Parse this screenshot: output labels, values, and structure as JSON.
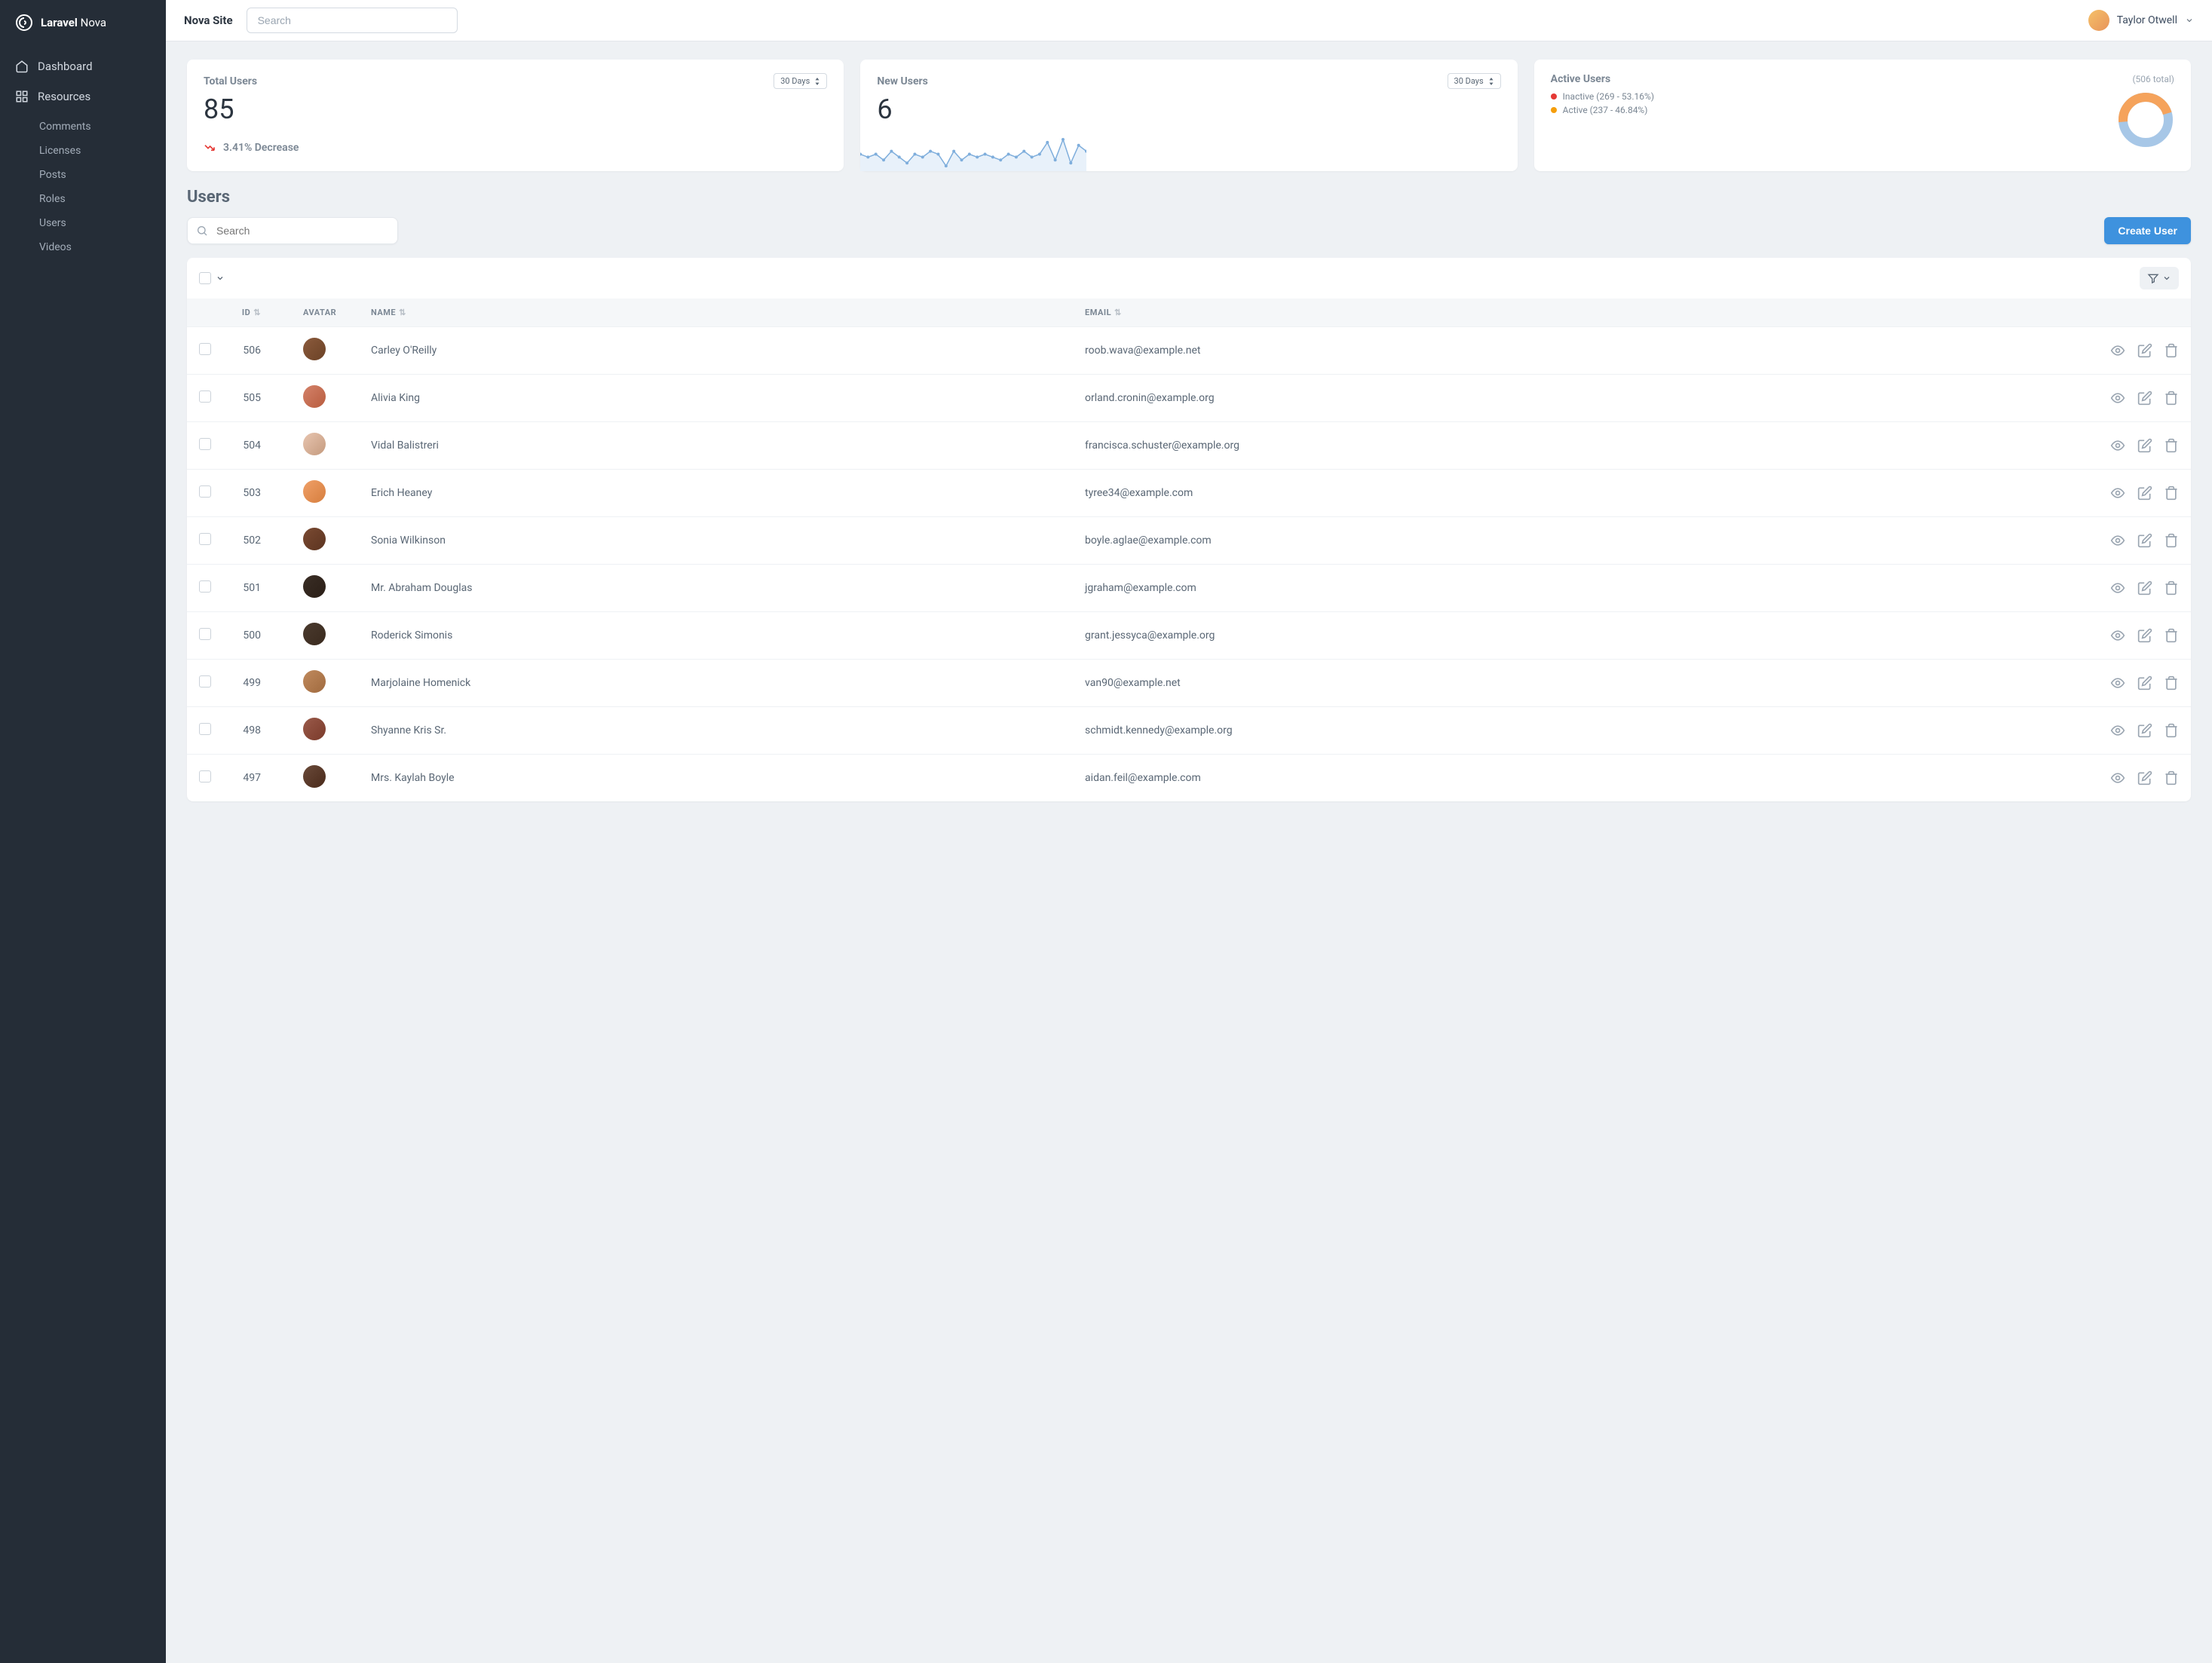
{
  "brand": {
    "name_bold": "Laravel",
    "name_light": "Nova"
  },
  "topbar": {
    "site_name": "Nova Site",
    "search_placeholder": "Search",
    "user_name": "Taylor Otwell"
  },
  "sidebar": {
    "nav": [
      {
        "label": "Dashboard",
        "icon": "home"
      },
      {
        "label": "Resources",
        "icon": "grid"
      }
    ],
    "resources": [
      {
        "label": "Comments"
      },
      {
        "label": "Licenses"
      },
      {
        "label": "Posts"
      },
      {
        "label": "Roles"
      },
      {
        "label": "Users"
      },
      {
        "label": "Videos"
      }
    ]
  },
  "cards": {
    "total_users": {
      "title": "Total Users",
      "range": "30 Days",
      "value": "85",
      "trend": "3.41% Decrease"
    },
    "new_users": {
      "title": "New Users",
      "range": "30 Days",
      "value": "6"
    },
    "active_users": {
      "title": "Active Users",
      "total": "(506 total)",
      "legend": [
        {
          "label": "Inactive (269 - 53.16%)",
          "color": "#E53935"
        },
        {
          "label": "Active (237 - 46.84%)",
          "color": "#F59E0B"
        }
      ]
    }
  },
  "chart_data": [
    {
      "type": "line",
      "title": "New Users",
      "x": [
        1,
        2,
        3,
        4,
        5,
        6,
        7,
        8,
        9,
        10,
        11,
        12,
        13,
        14,
        15,
        16,
        17,
        18,
        19,
        20,
        21,
        22,
        23,
        24,
        25,
        26,
        27,
        28,
        29,
        30
      ],
      "values": [
        5,
        4,
        5,
        3,
        6,
        4,
        2,
        5,
        4,
        6,
        5,
        1,
        6,
        3,
        5,
        4,
        5,
        4,
        3,
        5,
        4,
        6,
        4,
        5,
        9,
        3,
        10,
        2,
        8,
        6
      ],
      "ylim": [
        0,
        12
      ]
    },
    {
      "type": "pie",
      "title": "Active Users",
      "series": [
        {
          "name": "Inactive",
          "value": 269,
          "percent": 53.16,
          "color": "#A7C7E7"
        },
        {
          "name": "Active",
          "value": 237,
          "percent": 46.84,
          "color": "#F5A35C"
        }
      ],
      "total": 506
    }
  ],
  "section": {
    "title": "Users",
    "search_placeholder": "Search",
    "create_label": "Create User"
  },
  "table": {
    "columns": {
      "id": "ID",
      "avatar": "AVATAR",
      "name": "NAME",
      "email": "EMAIL"
    },
    "rows": [
      {
        "id": "506",
        "name": "Carley O'Reilly",
        "email": "roob.wava@example.net"
      },
      {
        "id": "505",
        "name": "Alivia King",
        "email": "orland.cronin@example.org"
      },
      {
        "id": "504",
        "name": "Vidal Balistreri",
        "email": "francisca.schuster@example.org"
      },
      {
        "id": "503",
        "name": "Erich Heaney",
        "email": "tyree34@example.com"
      },
      {
        "id": "502",
        "name": "Sonia Wilkinson",
        "email": "boyle.aglae@example.com"
      },
      {
        "id": "501",
        "name": "Mr. Abraham Douglas",
        "email": "jgraham@example.com"
      },
      {
        "id": "500",
        "name": "Roderick Simonis",
        "email": "grant.jessyca@example.org"
      },
      {
        "id": "499",
        "name": "Marjolaine Homenick",
        "email": "van90@example.net"
      },
      {
        "id": "498",
        "name": "Shyanne Kris Sr.",
        "email": "schmidt.kennedy@example.org"
      },
      {
        "id": "497",
        "name": "Mrs. Kaylah Boyle",
        "email": "aidan.feil@example.com"
      }
    ]
  }
}
